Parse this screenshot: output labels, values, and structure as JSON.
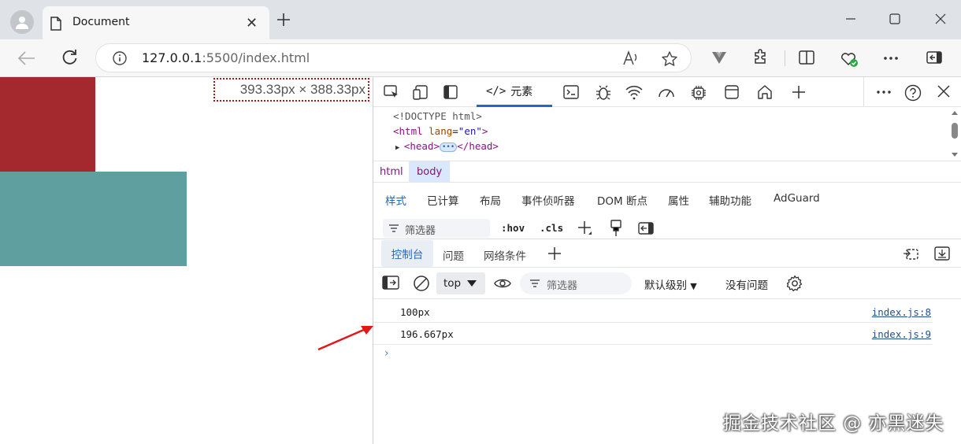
{
  "browser": {
    "tab_title": "Document",
    "url_host": "127.0.0.1",
    "url_rest": ":5500/index.html"
  },
  "page": {
    "dimension_label": "393.33px × 388.33px",
    "colors": {
      "red_box": "#a4292f",
      "teal_box": "#5f9f9f"
    }
  },
  "devtools": {
    "elements_tab": "元素",
    "dom": {
      "doctype": "<!DOCTYPE html>",
      "html_open": "<html ",
      "html_attr": "lang",
      "html_val": "\"en\"",
      "head_open": "<head>",
      "head_close": "</head>"
    },
    "breadcrumbs": [
      "html",
      "body"
    ],
    "style_tabs": [
      "样式",
      "已计算",
      "布局",
      "事件侦听器",
      "DOM 断点",
      "属性",
      "辅助功能",
      "AdGuard"
    ],
    "styles_filter_placeholder": "筛选器",
    "hov": ":hov",
    "cls": ".cls",
    "drawer_tabs": [
      "控制台",
      "问题",
      "网络条件"
    ],
    "console": {
      "context": "top",
      "filter_placeholder": "筛选器",
      "levels": "默认级别",
      "issues": "没有问题",
      "logs": [
        {
          "message": "100px",
          "source": "index.js:8"
        },
        {
          "message": "196.667px",
          "source": "index.js:9"
        }
      ],
      "prompt": "›"
    }
  },
  "watermark": "掘金技术社区 @ 亦黑迷失"
}
